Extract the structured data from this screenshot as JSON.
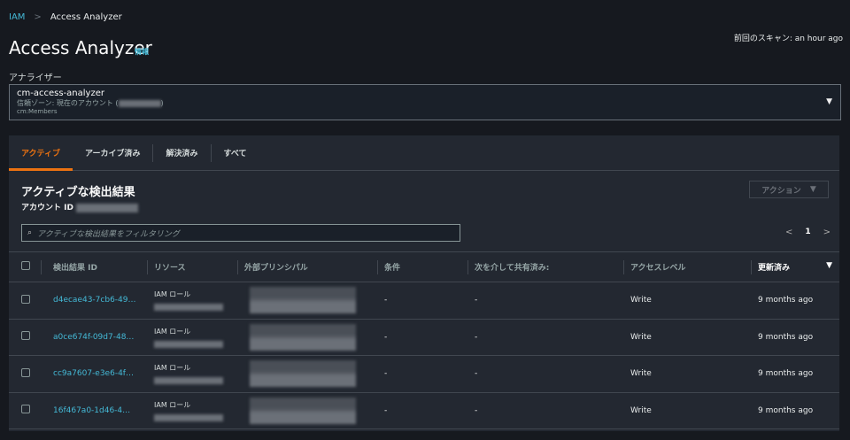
{
  "breadcrumb": {
    "root": "IAM",
    "current": "Access Analyzer"
  },
  "header": {
    "title": "Access Analyzer",
    "info": "情報",
    "last_scan": "前回のスキャン: an hour ago"
  },
  "analyzer": {
    "label": "アナライザー",
    "name": "cm-access-analyzer",
    "zone": "信頼ゾーン: 現在のアカウント (",
    "zone_end": ")",
    "tag": "cm:Members"
  },
  "tabs": [
    {
      "label": "アクティブ"
    },
    {
      "label": "アーカイブ済み"
    },
    {
      "label": "解決済み"
    },
    {
      "label": "すべて"
    }
  ],
  "findings": {
    "title": "アクティブな検出結果",
    "account_label": "アカウント ID",
    "action_label": "アクション",
    "filter_placeholder": "アクティブな検出結果をフィルタリング",
    "page": "1"
  },
  "columns": [
    "検出結果 ID",
    "リソース",
    "外部プリンシパル",
    "条件",
    "次を介して共有済み:",
    "アクセスレベル",
    "更新済み"
  ],
  "rows": [
    {
      "id": "d4ecae43-7cb6-49…",
      "resource_type": "IAM ロール",
      "condition": "-",
      "shared": "-",
      "access": "Write",
      "updated": "9 months ago"
    },
    {
      "id": "a0ce674f-09d7-48…",
      "resource_type": "IAM ロール",
      "condition": "-",
      "shared": "-",
      "access": "Write",
      "updated": "9 months ago"
    },
    {
      "id": "cc9a7607-e3e6-4f…",
      "resource_type": "IAM ロール",
      "condition": "-",
      "shared": "-",
      "access": "Write",
      "updated": "9 months ago"
    },
    {
      "id": "16f467a0-1d46-4…",
      "resource_type": "IAM ロール",
      "condition": "-",
      "shared": "-",
      "access": "Write",
      "updated": "9 months ago"
    }
  ]
}
